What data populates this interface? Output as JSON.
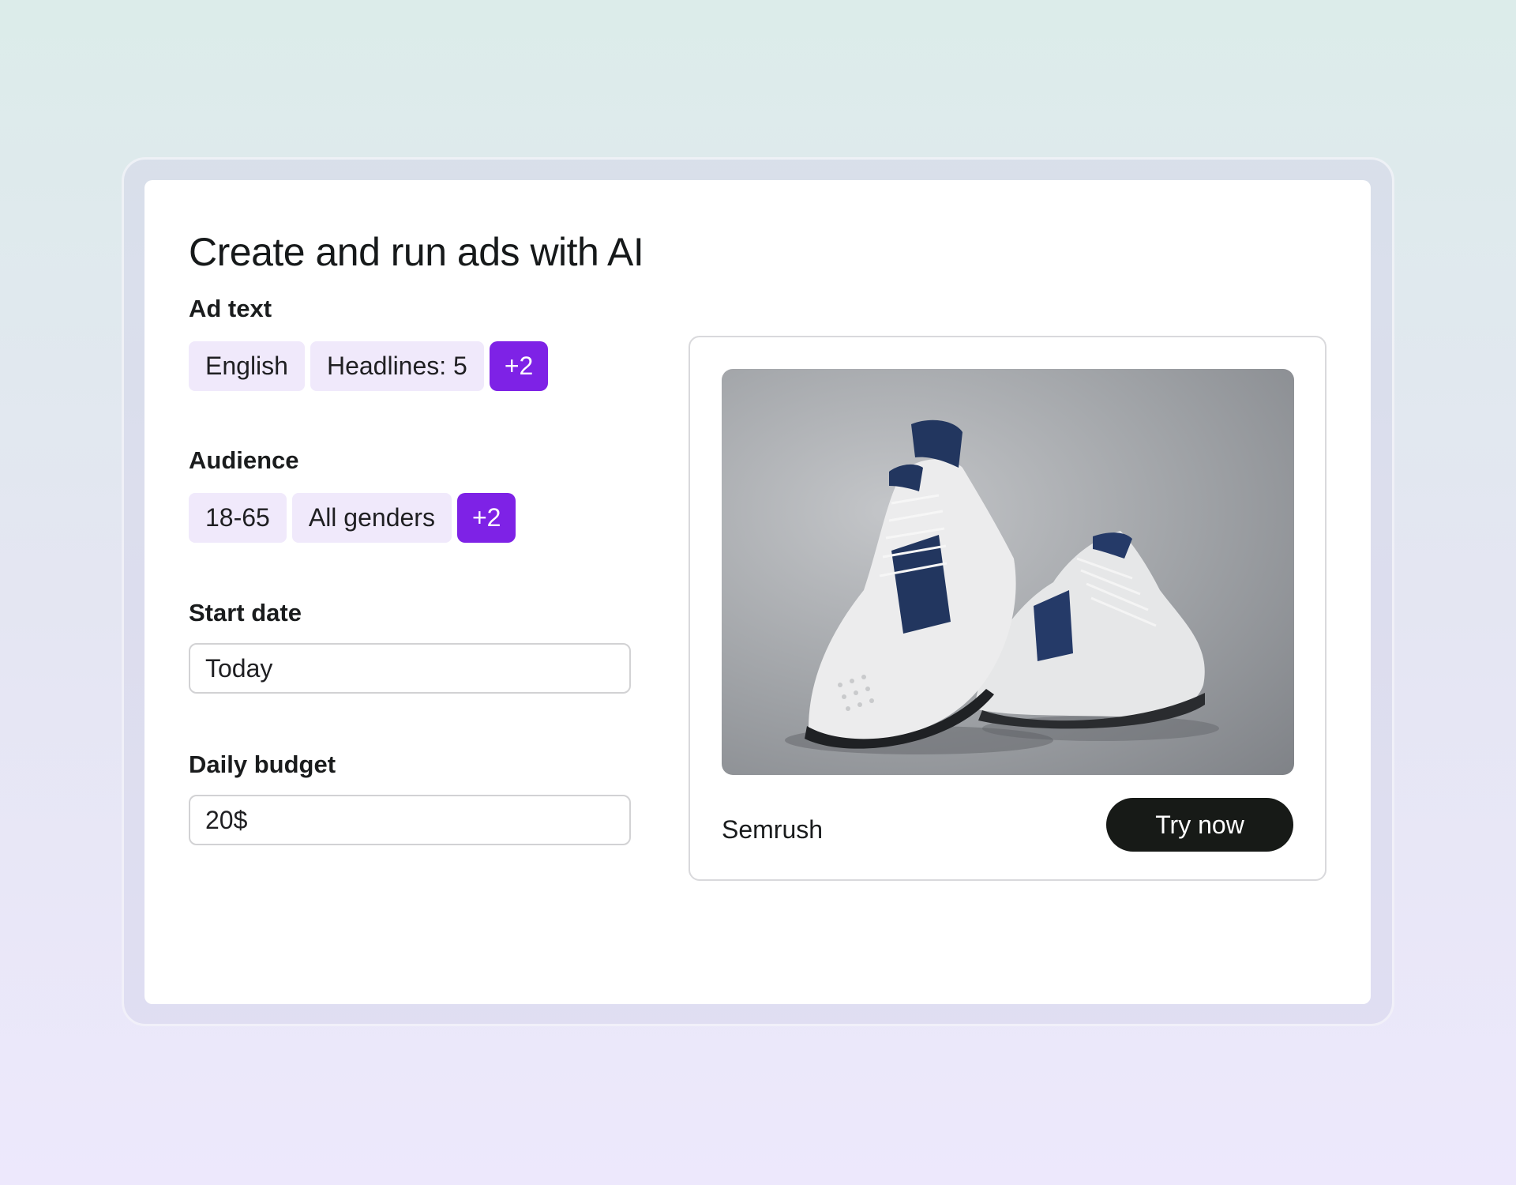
{
  "title": "Create and run ads with AI",
  "ad_text": {
    "label": "Ad text",
    "chips": [
      "English",
      "Headlines: 5"
    ],
    "more": "+2"
  },
  "audience": {
    "label": "Audience",
    "chips": [
      "18-65",
      "All genders"
    ],
    "more": "+2"
  },
  "start_date": {
    "label": "Start date",
    "value": "Today"
  },
  "daily_budget": {
    "label": "Daily budget",
    "value": "20$"
  },
  "preview": {
    "image_icon": "sneakers-photo",
    "brand": "Semrush",
    "cta": "Try now"
  },
  "colors": {
    "accent": "#7e22e6",
    "chip_bg": "#f0e9fb",
    "cta_bg": "#171a17"
  }
}
